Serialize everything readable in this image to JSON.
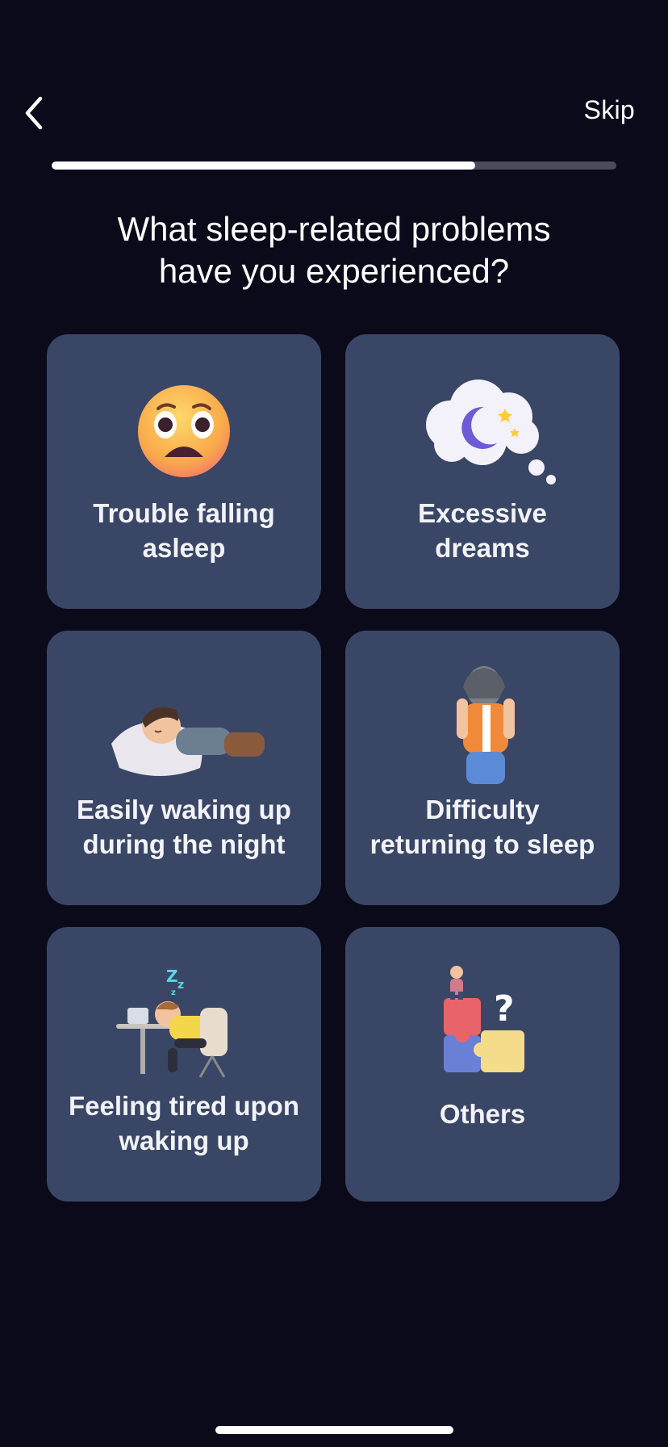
{
  "nav": {
    "back_icon": "chevron-left-icon",
    "skip_label": "Skip"
  },
  "progress": {
    "fraction": 0.75
  },
  "question": "What sleep-related problems\nhave you experienced?",
  "options": [
    {
      "label": "Trouble falling\nasleep",
      "icon": "anxious-face-icon"
    },
    {
      "label": "Excessive\ndreams",
      "icon": "dream-cloud-moon-icon"
    },
    {
      "label": "Easily waking up\nduring the night",
      "icon": "sleeping-person-icon"
    },
    {
      "label": "Difficulty\nreturning to sleep",
      "icon": "stressed-person-icon"
    },
    {
      "label": "Feeling tired upon\nwaking up",
      "icon": "tired-desk-person-icon"
    },
    {
      "label": "Others",
      "icon": "puzzle-question-icon"
    }
  ],
  "colors": {
    "background": "#0b0a1a",
    "card": "#3a4665",
    "progress_track": "#4a4b5a",
    "progress_fill": "#ffffff"
  }
}
